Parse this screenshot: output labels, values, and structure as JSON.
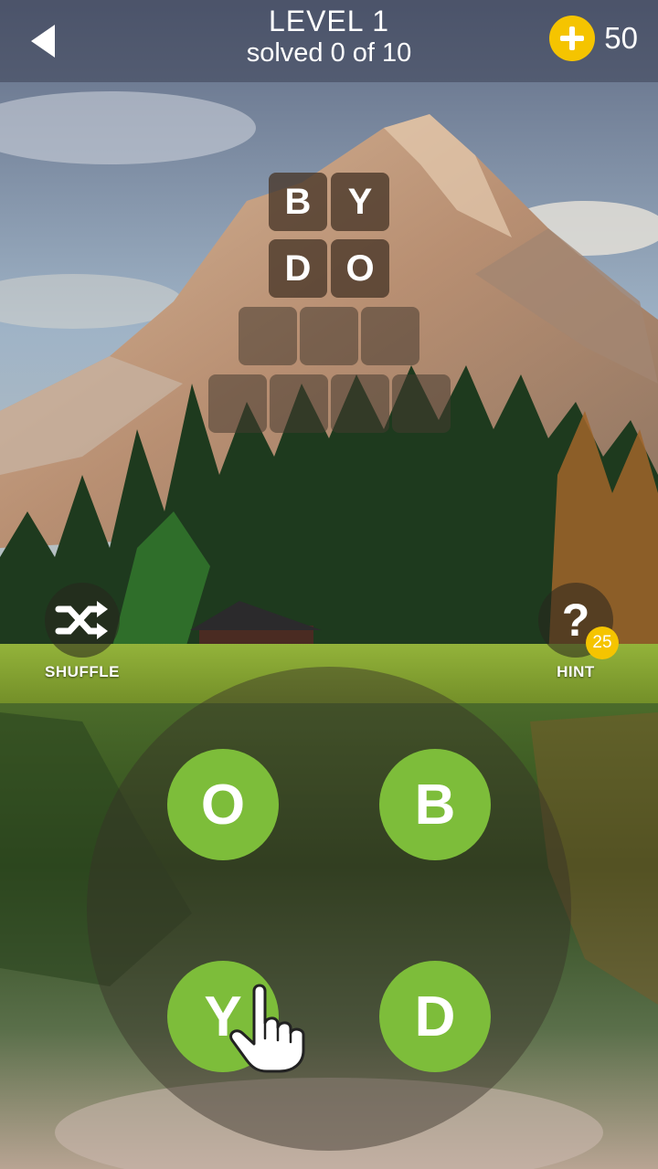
{
  "header": {
    "level_title": "LEVEL 1",
    "progress_text": "solved 0 of 10",
    "coins": "50"
  },
  "board": {
    "rows": [
      [
        "B",
        "Y"
      ],
      [
        "D",
        "O"
      ],
      [
        "",
        "",
        ""
      ],
      [
        "",
        "",
        "",
        ""
      ]
    ]
  },
  "controls": {
    "shuffle_label": "SHUFFLE",
    "hint_label": "HINT",
    "hint_cost": "25",
    "hint_symbol": "?"
  },
  "wheel": {
    "letters": [
      "O",
      "B",
      "Y",
      "D"
    ]
  },
  "icons": {
    "back": "back-arrow-icon",
    "coin": "plus-icon",
    "shuffle": "shuffle-icon",
    "hint": "question-icon",
    "pointer": "tutorial-hand-icon"
  },
  "colors": {
    "letter_button": "#7dbd3a",
    "coin": "#f5c400",
    "tile": "#48362899"
  }
}
